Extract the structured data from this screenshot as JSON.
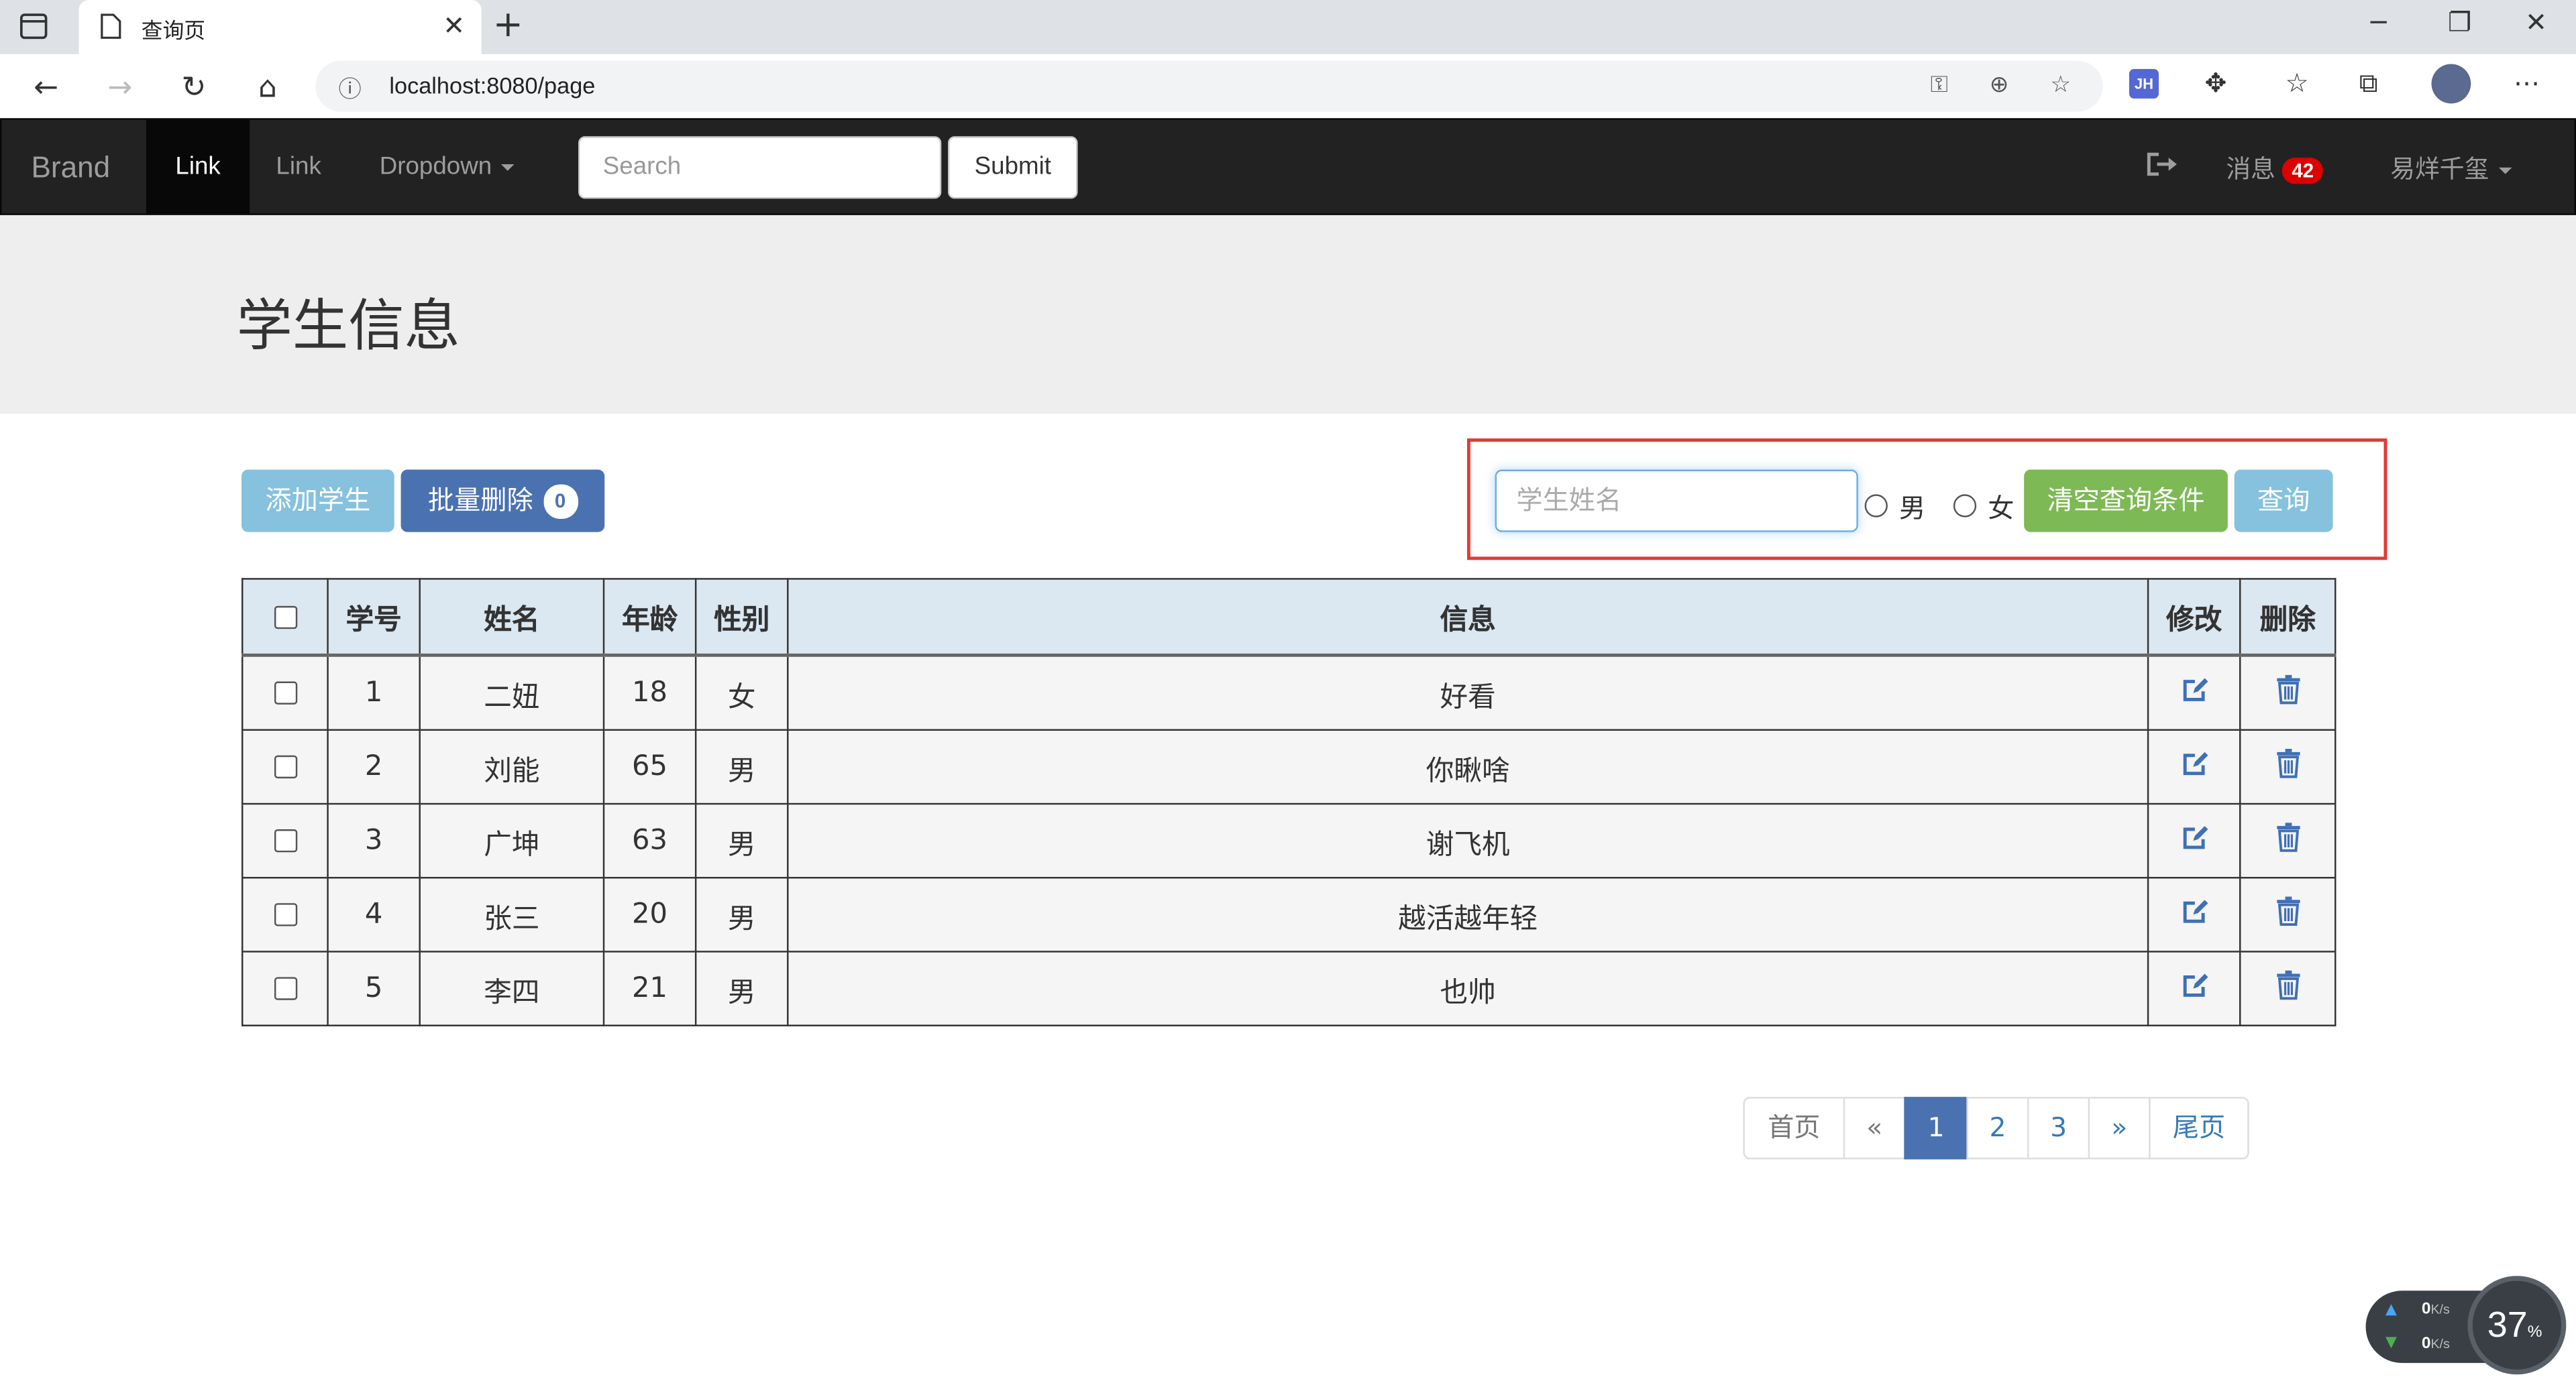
{
  "browser": {
    "tab_title": "查询页",
    "url": "localhost:8080/page",
    "ext_badge": "JH"
  },
  "navbar": {
    "brand": "Brand",
    "links": [
      "Link",
      "Link"
    ],
    "dropdown": "Dropdown",
    "search_placeholder": "Search",
    "submit": "Submit",
    "messages_label": "消息",
    "messages_count": "42",
    "user": "易烊千玺"
  },
  "page": {
    "title": "学生信息"
  },
  "actions": {
    "add": "添加学生",
    "batch_delete": "批量删除",
    "batch_count": "0"
  },
  "query": {
    "name_placeholder": "学生姓名",
    "male": "男",
    "female": "女",
    "clear": "清空查询条件",
    "search": "查询"
  },
  "table": {
    "headers": [
      "学号",
      "姓名",
      "年龄",
      "性别",
      "信息",
      "修改",
      "删除"
    ],
    "rows": [
      {
        "id": "1",
        "name": "二妞",
        "age": "18",
        "gender": "女",
        "info": "好看"
      },
      {
        "id": "2",
        "name": "刘能",
        "age": "65",
        "gender": "男",
        "info": "你瞅啥"
      },
      {
        "id": "3",
        "name": "广坤",
        "age": "63",
        "gender": "男",
        "info": "谢飞机"
      },
      {
        "id": "4",
        "name": "张三",
        "age": "20",
        "gender": "男",
        "info": "越活越年轻"
      },
      {
        "id": "5",
        "name": "李四",
        "age": "21",
        "gender": "男",
        "info": "也帅"
      }
    ]
  },
  "pagination": {
    "first": "首页",
    "prev": "«",
    "pages": [
      "1",
      "2",
      "3"
    ],
    "current": "1",
    "next": "»",
    "last": "尾页"
  },
  "speed_widget": {
    "up": "0",
    "down": "0",
    "unit": "K/s",
    "percent": "37",
    "percent_sign": "%"
  },
  "colors": {
    "navbar_bg": "#222222",
    "primary": "#4b72b0",
    "info": "#86c1de",
    "success": "#7db954",
    "highlight_border": "#e53935"
  }
}
